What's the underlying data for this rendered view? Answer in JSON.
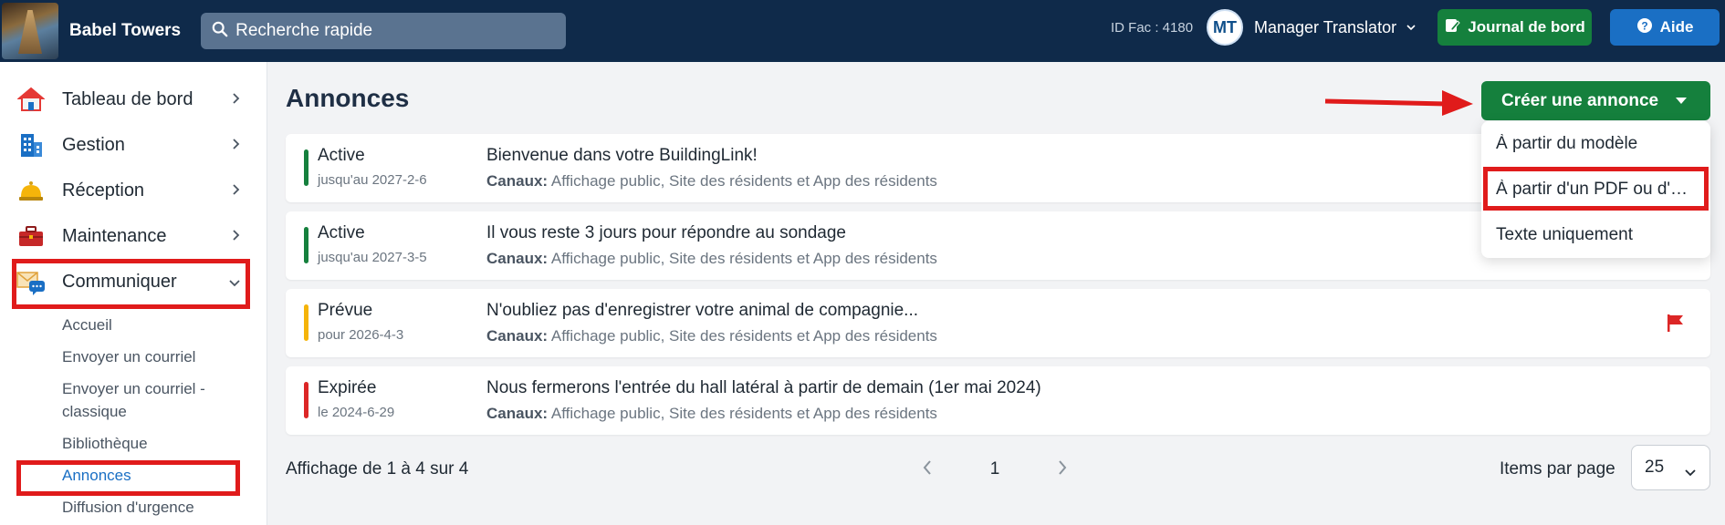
{
  "header": {
    "brand": "Babel Towers",
    "search_placeholder": "Recherche rapide",
    "id_fac": "ID Fac : 4180",
    "user_initials": "MT",
    "user_name": "Manager Translator",
    "journal_label": "Journal de bord",
    "help_label": "Aide"
  },
  "sidebar": {
    "items": [
      {
        "label": "Tableau de bord",
        "icon": "house-icon"
      },
      {
        "label": "Gestion",
        "icon": "building-icon"
      },
      {
        "label": "Réception",
        "icon": "service-bell-icon"
      },
      {
        "label": "Maintenance",
        "icon": "toolbox-icon"
      },
      {
        "label": "Communiquer",
        "icon": "envelope-chat-icon"
      }
    ],
    "subitems": [
      "Accueil",
      "Envoyer un courriel",
      "Envoyer un courriel -",
      "classique",
      "Bibliothèque",
      "Annonces",
      "Diffusion d'urgence"
    ]
  },
  "main": {
    "title": "Annonces",
    "create_button": "Créer une annonce",
    "dropdown": [
      "À partir du modèle",
      "À partir d'un PDF ou d'…",
      "Texte uniquement"
    ],
    "channels_label": "Canaux:",
    "announcements": [
      {
        "status": "Active",
        "until": "jusqu'au 2027-2-6",
        "title": "Bienvenue dans votre BuildingLink!",
        "channels": "Affichage public, Site des résidents et App des résidents",
        "color": "#15803d"
      },
      {
        "status": "Active",
        "until": "jusqu'au 2027-3-5",
        "title": "Il vous reste 3 jours pour répondre au sondage",
        "channels": "Affichage public, Site des résidents et App des résidents",
        "color": "#15803d"
      },
      {
        "status": "Prévue",
        "until": "pour 2026-4-3",
        "title": "N'oubliez pas d'enregistrer votre animal de compagnie...",
        "channels": "Affichage public, Site des résidents et App des résidents",
        "color": "#f5b40a"
      },
      {
        "status": "Expirée",
        "until": "le 2024-6-29",
        "title": "Nous fermerons l'entrée du hall latéral à partir de demain (1er mai 2024)",
        "channels": "Affichage public, Site des résidents et App des résidents",
        "color": "#dc2626"
      }
    ],
    "footer_info": "Affichage de 1 à 4 sur 4",
    "page_number": "1",
    "items_per_page_label": "Items par page",
    "items_per_page_value": "25"
  },
  "colors": {
    "topbar": "#0f2a4a",
    "green": "#15803d",
    "blue": "#1a6fc4",
    "highlight": "#e01b1b"
  }
}
